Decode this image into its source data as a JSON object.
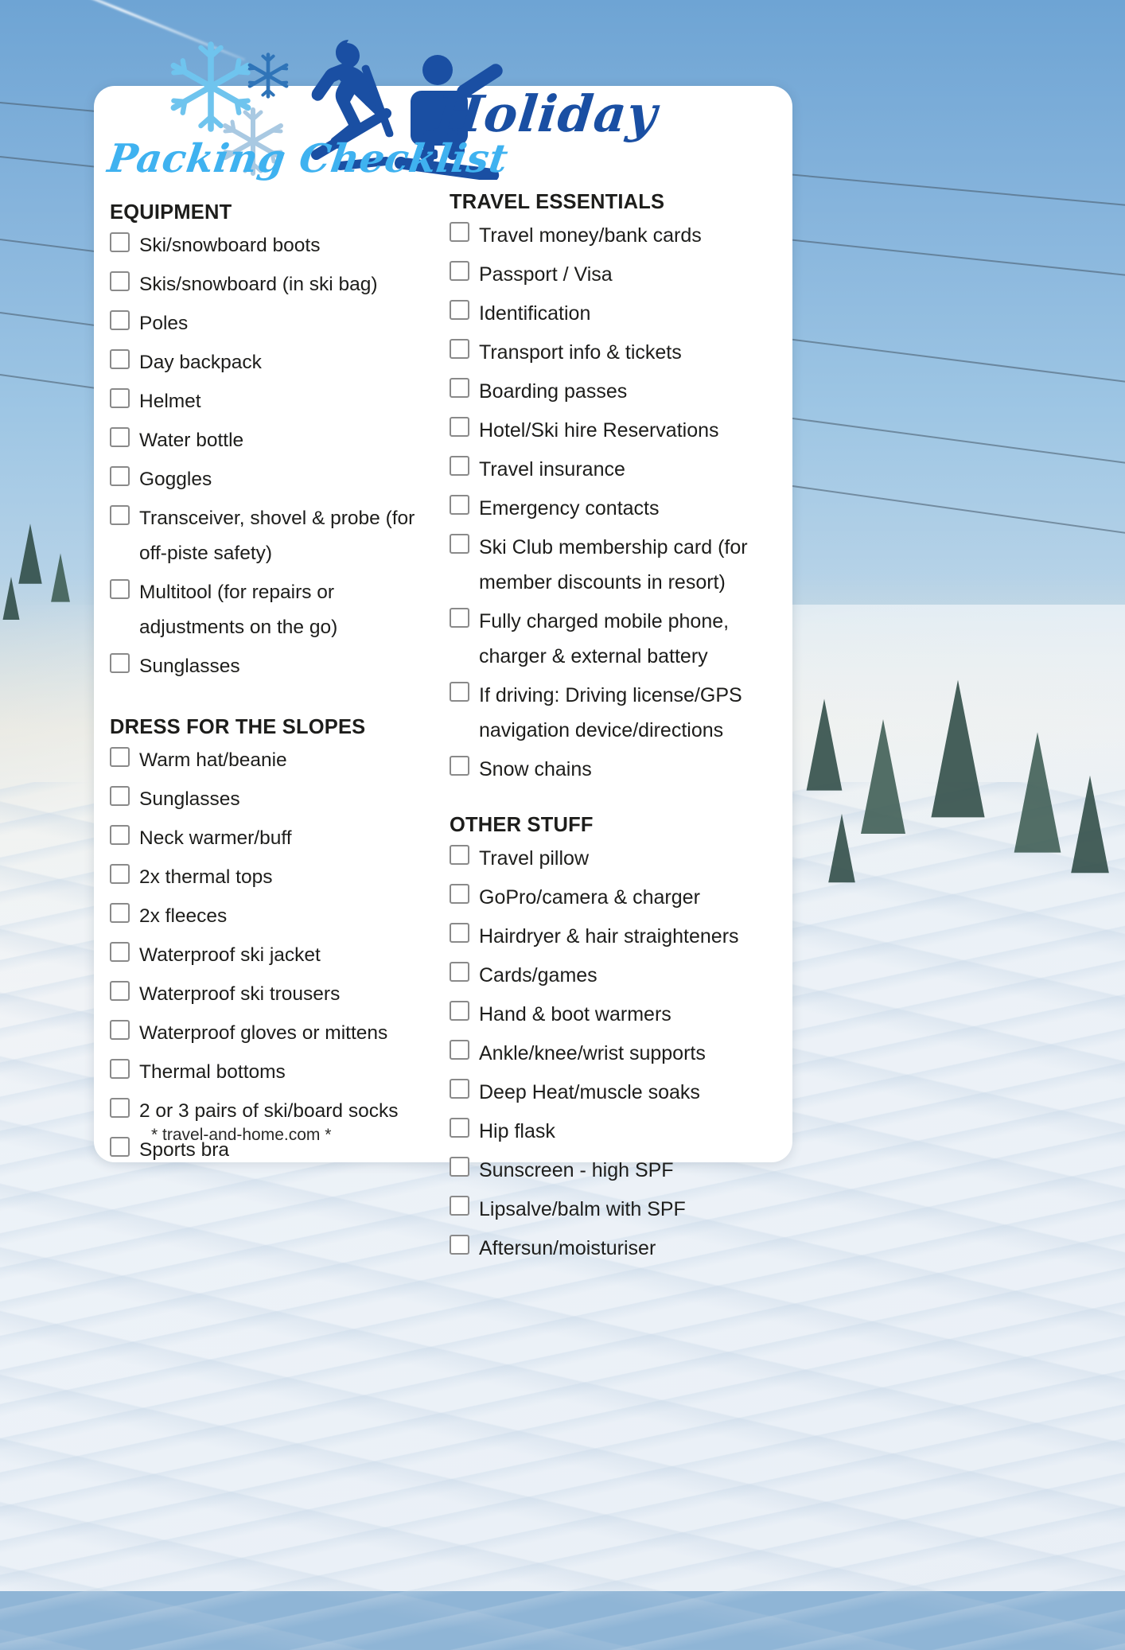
{
  "title": {
    "script_main": "Holiday",
    "script_sub": "Packing Checklist"
  },
  "icons": {
    "snowflake_large": "snowflake-icon",
    "snowflake_small": "snowflake-icon",
    "snowflake_medium": "snowflake-icon",
    "skier": "skier-icon",
    "snowboarder": "snowboarder-icon"
  },
  "colors": {
    "script_main": "#1a4fa3",
    "script_sub": "#3fb2f0",
    "silhouette": "#1a4fa3",
    "snowflake_light": "#6fc4ee",
    "snowflake_pale": "#a9c9e2",
    "heading": "#1d1d1b",
    "checkbox_border": "#8a8a8a",
    "card": "#ffffff"
  },
  "columns": {
    "left": [
      {
        "heading": "EQUIPMENT",
        "items": [
          "Ski/snowboard boots",
          "Skis/snowboard (in ski bag)",
          "Poles",
          "Day backpack",
          "Helmet",
          "Water bottle",
          "Goggles",
          "Transceiver, shovel & probe (for off-piste safety)",
          "Multitool (for repairs or adjustments on the go)",
          "Sunglasses"
        ]
      },
      {
        "heading": "DRESS FOR THE SLOPES",
        "items": [
          "Warm hat/beanie",
          "Sunglasses",
          "Neck warmer/buff",
          "2x thermal tops",
          "2x fleeces",
          "Waterproof ski jacket",
          "Waterproof ski trousers",
          "Waterproof gloves or mittens",
          "Thermal bottoms",
          "2 or 3 pairs of ski/board socks",
          "Sports bra"
        ]
      }
    ],
    "right": [
      {
        "heading": "TRAVEL ESSENTIALS",
        "items": [
          "Travel money/bank cards",
          "Passport / Visa",
          "Identification",
          "Transport info & tickets",
          "Boarding passes",
          "Hotel/Ski hire Reservations",
          "Travel insurance",
          "Emergency contacts",
          "Ski Club membership card (for member discounts in resort)",
          "Fully charged mobile phone, charger & external battery",
          "If driving: Driving license/GPS navigation device/directions",
          "Snow chains"
        ]
      },
      {
        "heading": "OTHER STUFF",
        "items": [
          "Travel pillow",
          "GoPro/camera & charger",
          "Hairdryer & hair straighteners",
          "Cards/games",
          "Hand & boot warmers",
          "Ankle/knee/wrist supports",
          "Deep Heat/muscle soaks",
          "Hip flask",
          "Sunscreen - high SPF",
          "Lipsalve/balm with SPF",
          "Aftersun/moisturiser"
        ]
      }
    ]
  },
  "footer": {
    "credit": "* travel-and-home.com *"
  }
}
